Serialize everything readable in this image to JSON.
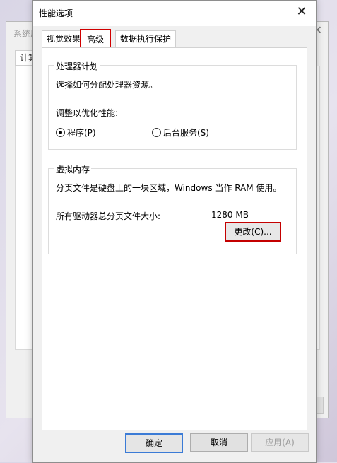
{
  "background_window": {
    "title": "系统属性",
    "tab": "计算",
    "close": "✕"
  },
  "dialog": {
    "title": "性能选项",
    "close": "✕",
    "tabs": [
      {
        "label": "视觉效果"
      },
      {
        "label": "高级"
      },
      {
        "label": "数据执行保护"
      }
    ],
    "processor_scheduling": {
      "legend": "处理器计划",
      "desc": "选择如何分配处理器资源。",
      "adjust_label": "调整以优化性能:",
      "options": [
        {
          "label": "程序(P)",
          "checked": true
        },
        {
          "label": "后台服务(S)",
          "checked": false
        }
      ]
    },
    "virtual_memory": {
      "legend": "虚拟内存",
      "desc": "分页文件是硬盘上的一块区域，Windows 当作 RAM 使用。",
      "total_label": "所有驱动器总分页文件大小:",
      "total_value": "1280 MB",
      "change_button": "更改(C)..."
    },
    "buttons": {
      "ok": "确定",
      "cancel": "取消",
      "apply": "应用(A)"
    }
  }
}
